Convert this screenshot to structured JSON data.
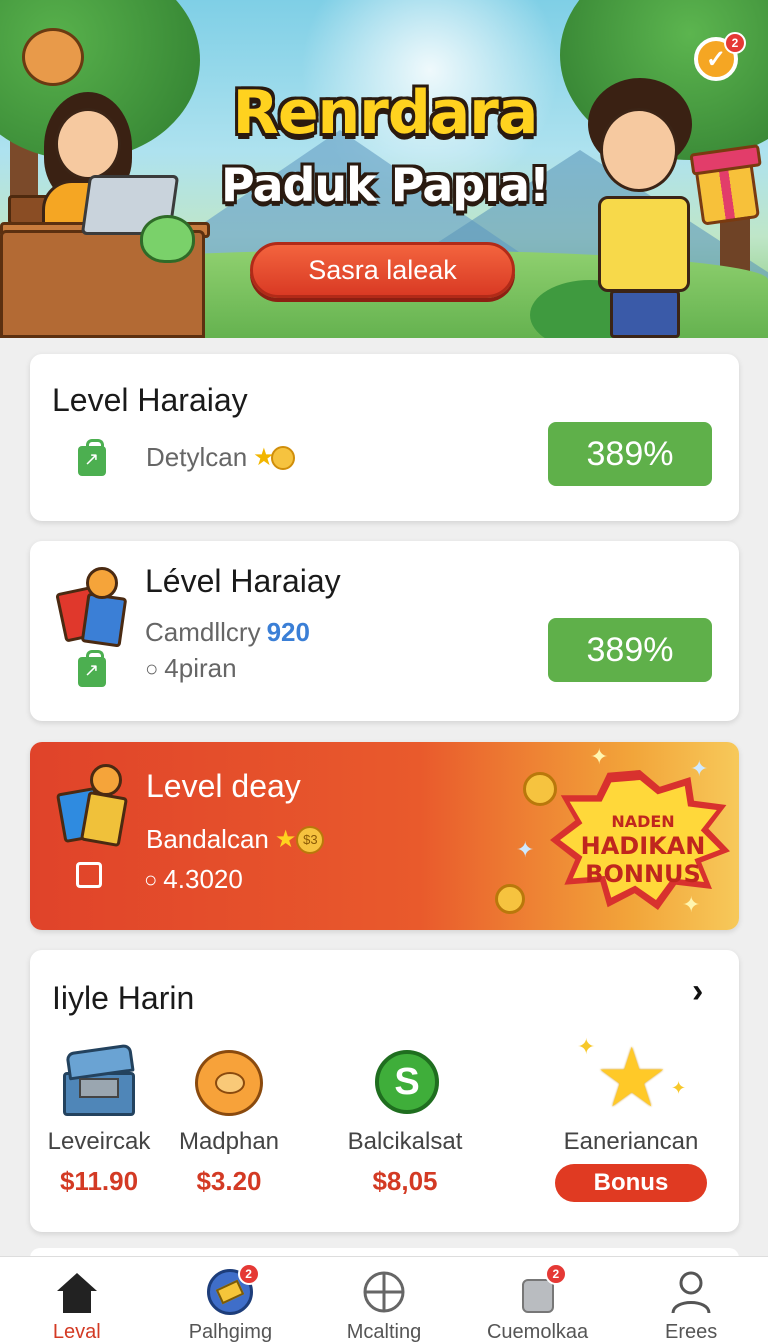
{
  "banner": {
    "title": "Renrdara",
    "subtitle": "Paduk Papıa!",
    "cta_label": "Sasra laleak",
    "badge_count": "2"
  },
  "cards": [
    {
      "title": "Level Haraiay",
      "subtitle": "Detylcan",
      "percent": "389%"
    },
    {
      "title": "Lével Haraiay",
      "subtitle": "Camdllcry",
      "subtitle_value": "920",
      "meta": "4piran",
      "percent": "389%"
    }
  ],
  "promo": {
    "title": "Level deay",
    "subtitle": "Bandalcan",
    "coin_value": "$3",
    "meta": "4.3020",
    "burst_line1": "NADEN",
    "burst_line2": "HADIKAN",
    "burst_line3": "BONNUS"
  },
  "offers": {
    "title": "Iiyle Harin",
    "items": [
      {
        "name": "Leveircak",
        "price": "$11.90",
        "icon": "treasure-chest-icon"
      },
      {
        "name": "Madphan",
        "price": "$3.20",
        "icon": "sun-mascot-icon"
      },
      {
        "name": "Balcikalsat",
        "price": "$8,05",
        "icon": "dollar-coin-icon"
      },
      {
        "name": "Eaneriancan",
        "button": "Bonus",
        "icon": "star-icon"
      }
    ]
  },
  "nav": {
    "items": [
      {
        "label": "Leval",
        "icon": "home-icon",
        "active": true
      },
      {
        "label": "Palhgimg",
        "icon": "card-icon",
        "badge": "2"
      },
      {
        "label": "Mcalting",
        "icon": "crosshair-icon"
      },
      {
        "label": "Cuemolkaa",
        "icon": "bag-icon",
        "badge": "2"
      },
      {
        "label": "Erees",
        "icon": "user-icon"
      }
    ]
  },
  "colors": {
    "accent_red": "#d33a24",
    "success_green": "#5fb04a",
    "title_yellow": "#ffd21f"
  }
}
